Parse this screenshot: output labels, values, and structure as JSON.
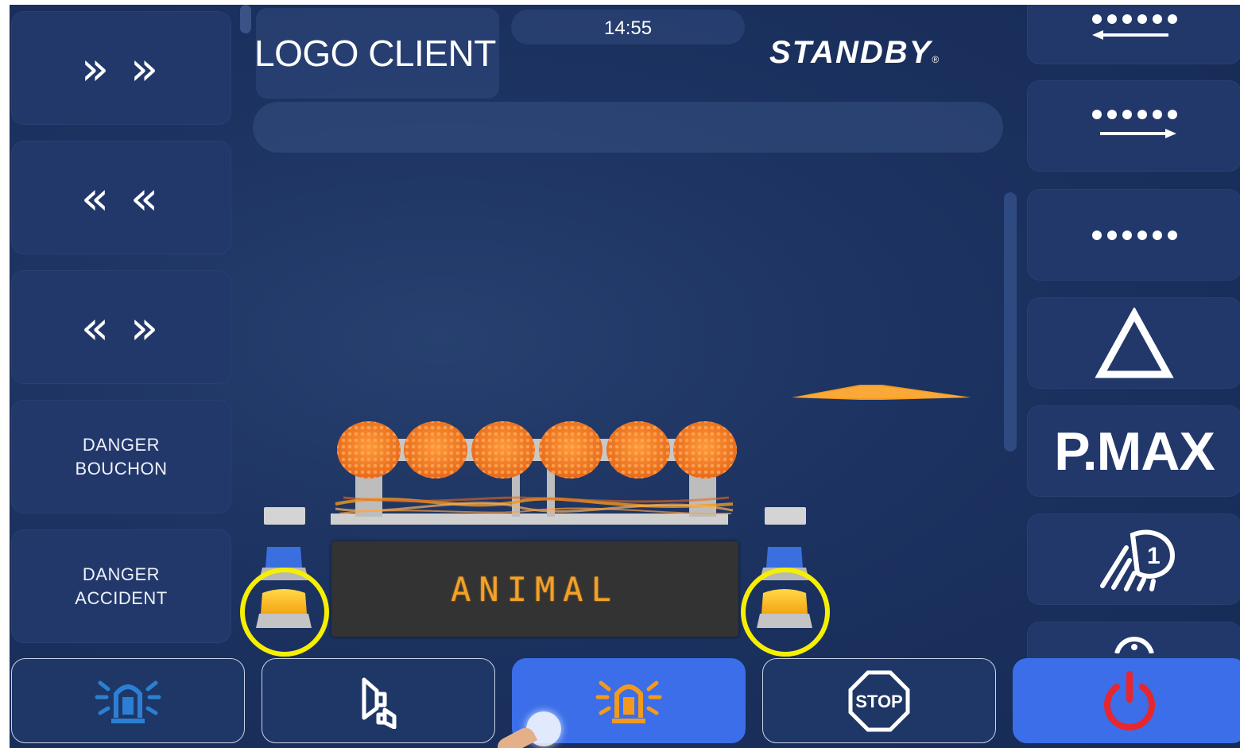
{
  "header": {
    "logo_text": "LOGO CLIENT",
    "clock": "14:55",
    "brand": "STANDBY",
    "brand_mark": "®"
  },
  "left_buttons": [
    {
      "label": "» »",
      "icon": "double-chevron-right-icon"
    },
    {
      "label": "« «",
      "icon": "double-chevron-left-icon"
    },
    {
      "label": "« »",
      "icon": "chevron-outward-icon"
    },
    {
      "label_line1": "DANGER",
      "label_line2": "BOUCHON"
    },
    {
      "label_line1": "DANGER",
      "label_line2": "ACCIDENT"
    }
  ],
  "right_buttons": [
    {
      "icon": "dots-arrow-left-icon"
    },
    {
      "icon": "dots-arrow-right-icon"
    },
    {
      "icon": "dots-row-icon"
    },
    {
      "icon": "warning-triangle-icon"
    },
    {
      "label": "P.MAX"
    },
    {
      "icon": "headlight-1-icon",
      "number": "1"
    },
    {
      "icon": "headlight-2-icon"
    }
  ],
  "vehicle": {
    "sign_message": "ANIMAL",
    "arrow_panel_lamps": 6,
    "left_beacon": "amber-on",
    "right_beacon": "amber-on"
  },
  "bottom_buttons": [
    {
      "icon": "blue-beacon-icon",
      "active": false
    },
    {
      "icon": "siren-speaker-icon",
      "active": false
    },
    {
      "icon": "amber-beacon-icon",
      "active": true
    },
    {
      "icon": "stop-sign-icon",
      "label": "STOP",
      "active": false
    },
    {
      "icon": "power-icon",
      "active": true
    }
  ],
  "colors": {
    "background": "#1c3260",
    "button": "#23386a",
    "active_button": "#3b6ee8",
    "amber": "#f39a1e",
    "blue_beacon": "#2b7fd4",
    "power_red": "#e8262d",
    "highlight_ring": "#f6f000",
    "sign_text": "#f2a12a"
  }
}
